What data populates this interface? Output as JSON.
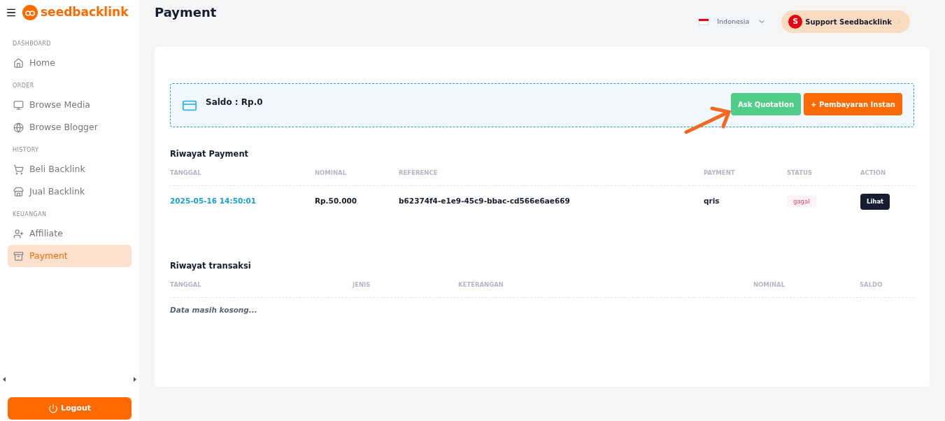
{
  "brand": {
    "name": "seedbacklink"
  },
  "sidebar": {
    "sections": [
      {
        "heading": "DASHBOARD",
        "items": [
          {
            "label": "Home",
            "selected": false
          }
        ]
      },
      {
        "heading": "ORDER",
        "items": [
          {
            "label": "Browse Media",
            "selected": false
          },
          {
            "label": "Browse Blogger",
            "selected": false
          }
        ]
      },
      {
        "heading": "HISTORY",
        "items": [
          {
            "label": "Beli Backlink",
            "selected": false
          },
          {
            "label": "Jual Backlink",
            "selected": false
          }
        ]
      },
      {
        "heading": "KEUANGAN",
        "items": [
          {
            "label": "Affiliate",
            "selected": false
          },
          {
            "label": "Payment",
            "selected": true
          }
        ]
      }
    ],
    "logout": "Logout"
  },
  "page_title": "Payment",
  "language": {
    "label": "Indonesia"
  },
  "support": {
    "badge": "S",
    "label": "Support Seedbacklink"
  },
  "balance": {
    "label": "Saldo : Rp.0",
    "buttons": [
      {
        "label": "Ask Quotation",
        "kind": "green"
      },
      {
        "label": "+ Pembayaran Instan",
        "kind": "orange"
      }
    ]
  },
  "payment_history": {
    "title": "Riwayat Payment",
    "columns": [
      "TANGGAL",
      "NOMINAL",
      "REFERENCE",
      "PAYMENT",
      "STATUS",
      "ACTION"
    ],
    "rows": [
      {
        "date": "2025-05-16 14:50:01",
        "nominal": "Rp.50.000",
        "reference": "b62374f4-e1e9-45c9-bbac-cd566e6ae669",
        "payment": "qris",
        "status": {
          "label": "gagal",
          "kind": "failed"
        },
        "action": "Lihat"
      }
    ]
  },
  "transaction_history": {
    "title": "Riwayat transaksi",
    "columns": [
      "TANGGAL",
      "JENIS",
      "KETERANGAN",
      "NOMINAL",
      "SALDO"
    ],
    "empty": "Data masih kosong..."
  }
}
